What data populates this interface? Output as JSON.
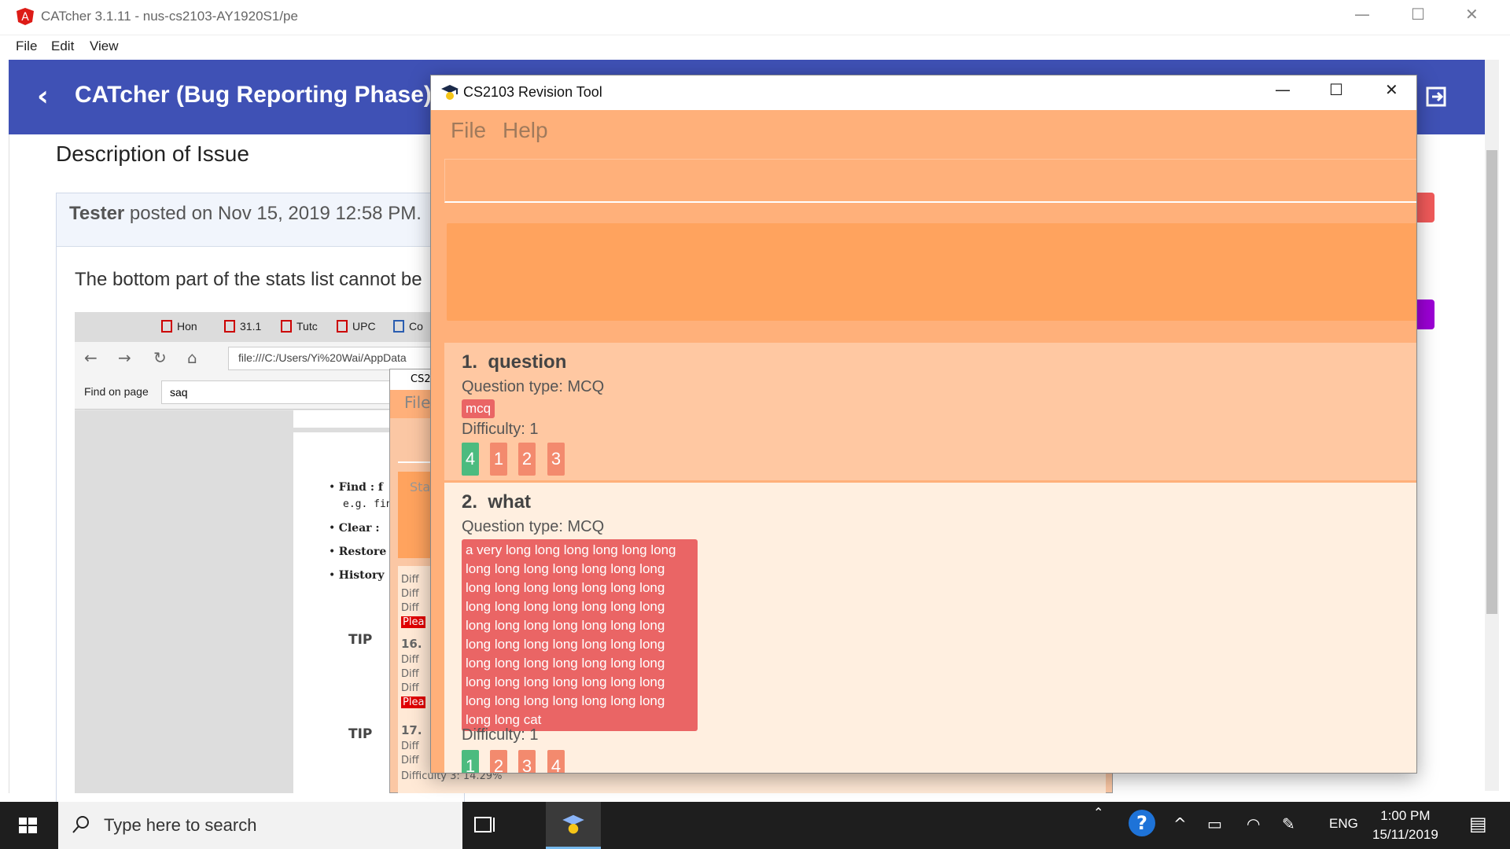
{
  "catcher": {
    "window_title": "CATcher 3.1.11 - nus-cs2103-AY1920S1/pe",
    "menu": [
      "File",
      "Edit",
      "View"
    ],
    "header_title": "CATcher  (Bug Reporting Phase)",
    "description_title": "Description of Issue",
    "comment": {
      "author": "Tester",
      "posted": " posted on Nov 15, 2019 12:58 PM.",
      "text": "The bottom part of the stats list cannot be"
    },
    "embedded_screenshot": {
      "tabs": [
        "Hon",
        "31.1",
        "Tutc",
        "UPC",
        "Co"
      ],
      "url": "file:///C:/Users/Yi%20Wai/AppData",
      "find_label": "Find on page",
      "find_value": "saq",
      "bullets": [
        "Find : f",
        "e.g. fin",
        "Clear :",
        "Restore",
        "History"
      ],
      "tips": [
        "TIP",
        "TIP"
      ],
      "mini_window": {
        "title": "CS2",
        "menu": "File",
        "placeholder": "Sta",
        "lines_a": [
          "Diff",
          "Diff",
          "Diff"
        ],
        "red_a": "Plea",
        "index_16": "16.",
        "lines_b": [
          "Diff",
          "Diff",
          "Diff"
        ],
        "red_b": "Plea",
        "index_17": "17.",
        "lines_c": [
          "Diff",
          "Diff"
        ],
        "footer": "Difficulty 3: 14.29%"
      }
    }
  },
  "revision_tool": {
    "window_title": "CS2103 Revision Tool",
    "menu": [
      "File",
      "Help"
    ],
    "questions": [
      {
        "index": "1.",
        "title": "question",
        "type": "Question type: MCQ",
        "tag": "mcq",
        "difficulty": "Difficulty: 1",
        "options": [
          "4",
          "1",
          "2",
          "3"
        ]
      },
      {
        "index": "2.",
        "title": "what",
        "type": "Question type: MCQ",
        "tag": "a very long long long long long long long long long long long long long long long long long long long long long long long long long long long long long long long long long long long long long long long long long long long long long long long long long long long long long long long long long long long long long long long long cat",
        "difficulty": "Difficulty: 1",
        "options": [
          "1",
          "2",
          "3",
          "4"
        ]
      }
    ]
  },
  "taskbar": {
    "search_placeholder": "Type here to search",
    "language": "ENG",
    "time": "1:00 PM",
    "date": "15/11/2019"
  },
  "colors": {
    "catcher_header": "#3f51b5",
    "revision_bg": "#ffb07a",
    "tag_red": "#ea6565",
    "option_green": "#4cbb7f",
    "option_orange": "#f38a6e"
  }
}
